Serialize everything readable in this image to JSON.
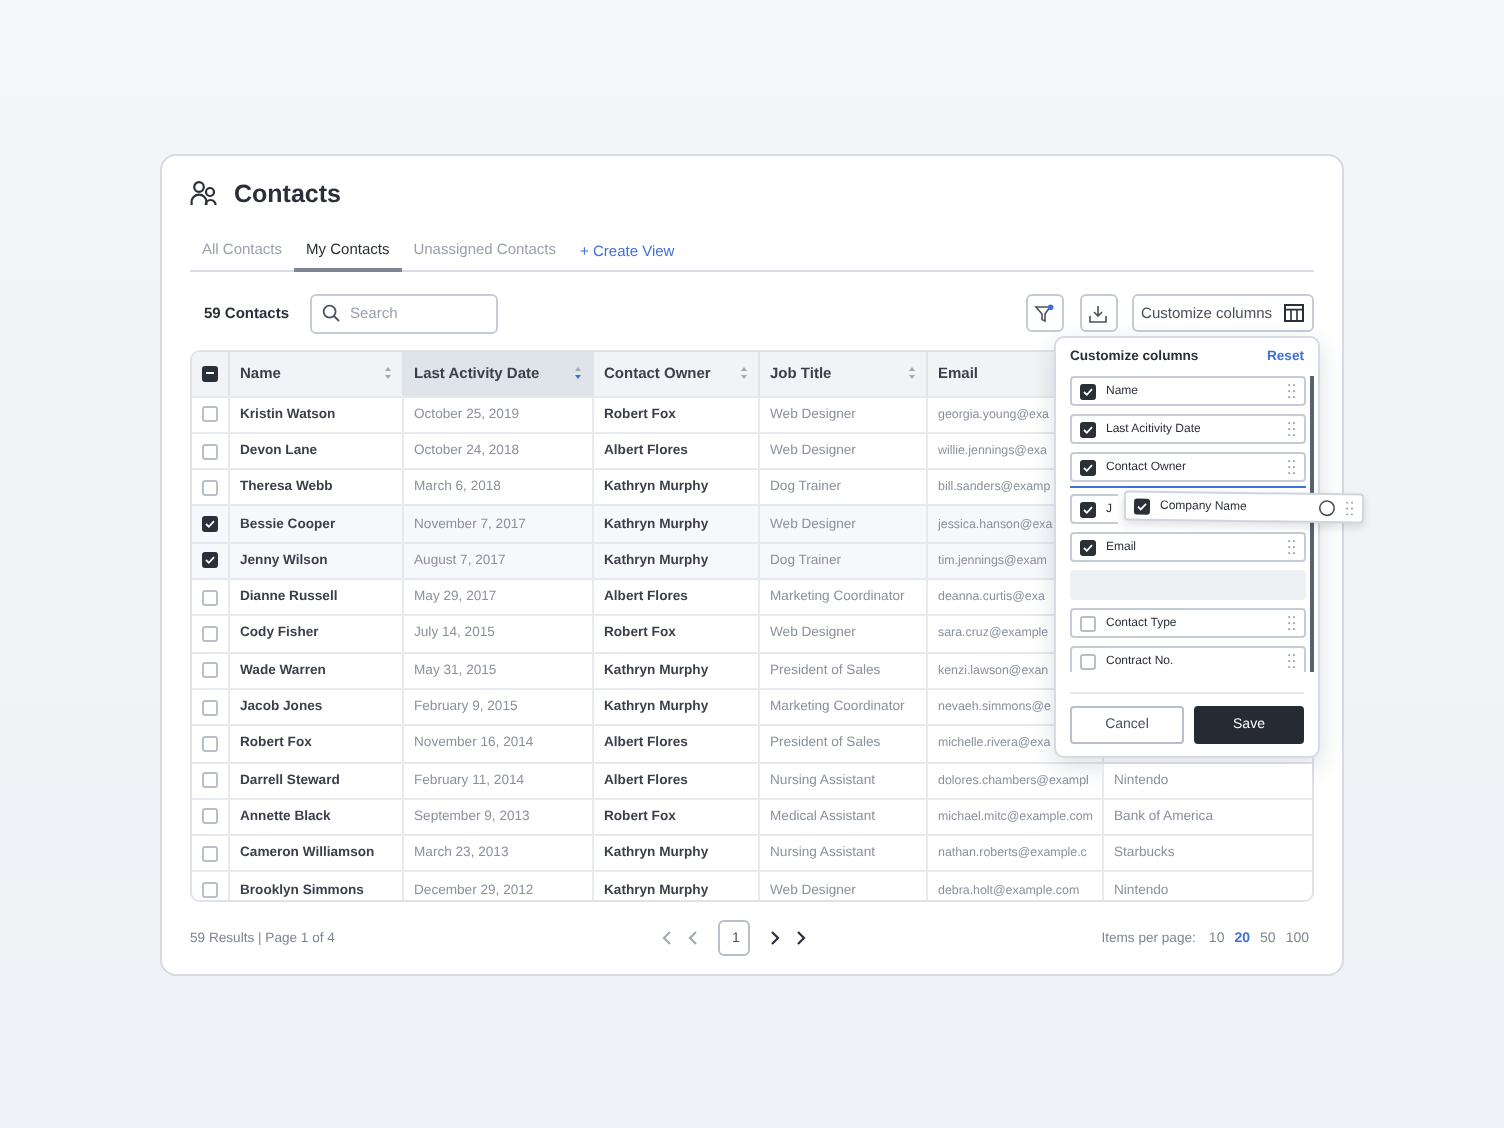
{
  "page": {
    "title": "Contacts"
  },
  "tabs": [
    {
      "label": "All Contacts",
      "selected": false
    },
    {
      "label": "My Contacts",
      "selected": true
    },
    {
      "label": "Unassigned Contacts",
      "selected": false
    }
  ],
  "create_view": "+ Create View",
  "toolbar": {
    "count": "59 Contacts",
    "search_placeholder": "Search",
    "filter_active": true,
    "customize_label": "Customize columns"
  },
  "table": {
    "select_all_indeterminate": true,
    "columns": [
      {
        "label": "Name",
        "sorted": false
      },
      {
        "label": "Last Activity Date",
        "sorted": true
      },
      {
        "label": "Contact Owner",
        "sorted": false
      },
      {
        "label": "Job Title",
        "sorted": false
      },
      {
        "label": "Email",
        "sorted": false
      }
    ],
    "rows": [
      {
        "name": "Kristin Watson",
        "date": "October 25, 2019",
        "owner": "Robert Fox",
        "job": "Web Designer",
        "email": "georgia.young@exa",
        "selected": false
      },
      {
        "name": "Devon Lane",
        "date": "October 24, 2018",
        "owner": "Albert Flores",
        "job": "Web Designer",
        "email": "willie.jennings@exa",
        "selected": false
      },
      {
        "name": "Theresa Webb",
        "date": "March 6, 2018",
        "owner": "Kathryn Murphy",
        "job": "Dog Trainer",
        "email": "bill.sanders@examp",
        "selected": false
      },
      {
        "name": "Bessie Cooper",
        "date": "November 7, 2017",
        "owner": "Kathryn Murphy",
        "job": "Web Designer",
        "email": "jessica.hanson@exa",
        "selected": true
      },
      {
        "name": "Jenny Wilson",
        "date": "August 7, 2017",
        "owner": "Kathryn Murphy",
        "job": "Dog Trainer",
        "email": "tim.jennings@exam",
        "selected": true
      },
      {
        "name": "Dianne Russell",
        "date": "May 29, 2017",
        "owner": "Albert Flores",
        "job": "Marketing Coordinator",
        "email": "deanna.curtis@exa",
        "selected": false
      },
      {
        "name": "Cody Fisher",
        "date": "July 14, 2015",
        "owner": "Robert Fox",
        "job": "Web Designer",
        "email": "sara.cruz@example",
        "selected": false
      },
      {
        "name": "Wade Warren",
        "date": "May 31, 2015",
        "owner": "Kathryn Murphy",
        "job": "President of Sales",
        "email": "kenzi.lawson@exan",
        "selected": false
      },
      {
        "name": "Jacob Jones",
        "date": "February 9, 2015",
        "owner": "Kathryn Murphy",
        "job": "Marketing Coordinator",
        "email": "nevaeh.simmons@e",
        "selected": false
      },
      {
        "name": "Robert Fox",
        "date": "November 16, 2014",
        "owner": "Albert Flores",
        "job": "President of Sales",
        "email": "michelle.rivera@exa",
        "selected": false
      },
      {
        "name": "Darrell Steward",
        "date": "February 11, 2014",
        "owner": "Albert Flores",
        "job": "Nursing Assistant",
        "email": "dolores.chambers@exampl",
        "company": "Nintendo",
        "selected": false
      },
      {
        "name": "Annette Black",
        "date": "September 9, 2013",
        "owner": "Robert Fox",
        "job": "Medical Assistant",
        "email": "michael.mitc@example.com",
        "company": "Bank of America",
        "selected": false
      },
      {
        "name": "Cameron Williamson",
        "date": "March 23, 2013",
        "owner": "Kathryn Murphy",
        "job": "Nursing Assistant",
        "email": "nathan.roberts@example.c",
        "company": "Starbucks",
        "selected": false
      },
      {
        "name": "Brooklyn Simmons",
        "date": "December 29, 2012",
        "owner": "Kathryn Murphy",
        "job": "Web Designer",
        "email": "debra.holt@example.com",
        "company": "Nintendo",
        "selected": false
      }
    ]
  },
  "popover": {
    "title": "Customize columns",
    "reset": "Reset",
    "items": [
      {
        "kind": "item",
        "label": "Name",
        "checked": true
      },
      {
        "kind": "item",
        "label": "Last Acitivity Date",
        "checked": true
      },
      {
        "kind": "item",
        "label": "Contact Owner",
        "checked": true
      },
      {
        "kind": "item",
        "label": "J",
        "checked": true
      },
      {
        "kind": "item",
        "label": "Email",
        "checked": true
      },
      {
        "kind": "slot"
      },
      {
        "kind": "item",
        "label": "Contact Type",
        "checked": false
      },
      {
        "kind": "item",
        "label": "Contract No.",
        "checked": false
      }
    ],
    "dragging": {
      "label": "Company Name",
      "checked": true
    },
    "cancel": "Cancel",
    "save": "Save"
  },
  "footer": {
    "results": "59 Results | Page 1 of 4",
    "page": "1",
    "per_page_label": "Items per page:",
    "per_page": [
      {
        "label": "10",
        "selected": false
      },
      {
        "label": "20",
        "selected": true
      },
      {
        "label": "50",
        "selected": false
      },
      {
        "label": "100",
        "selected": false
      }
    ]
  }
}
